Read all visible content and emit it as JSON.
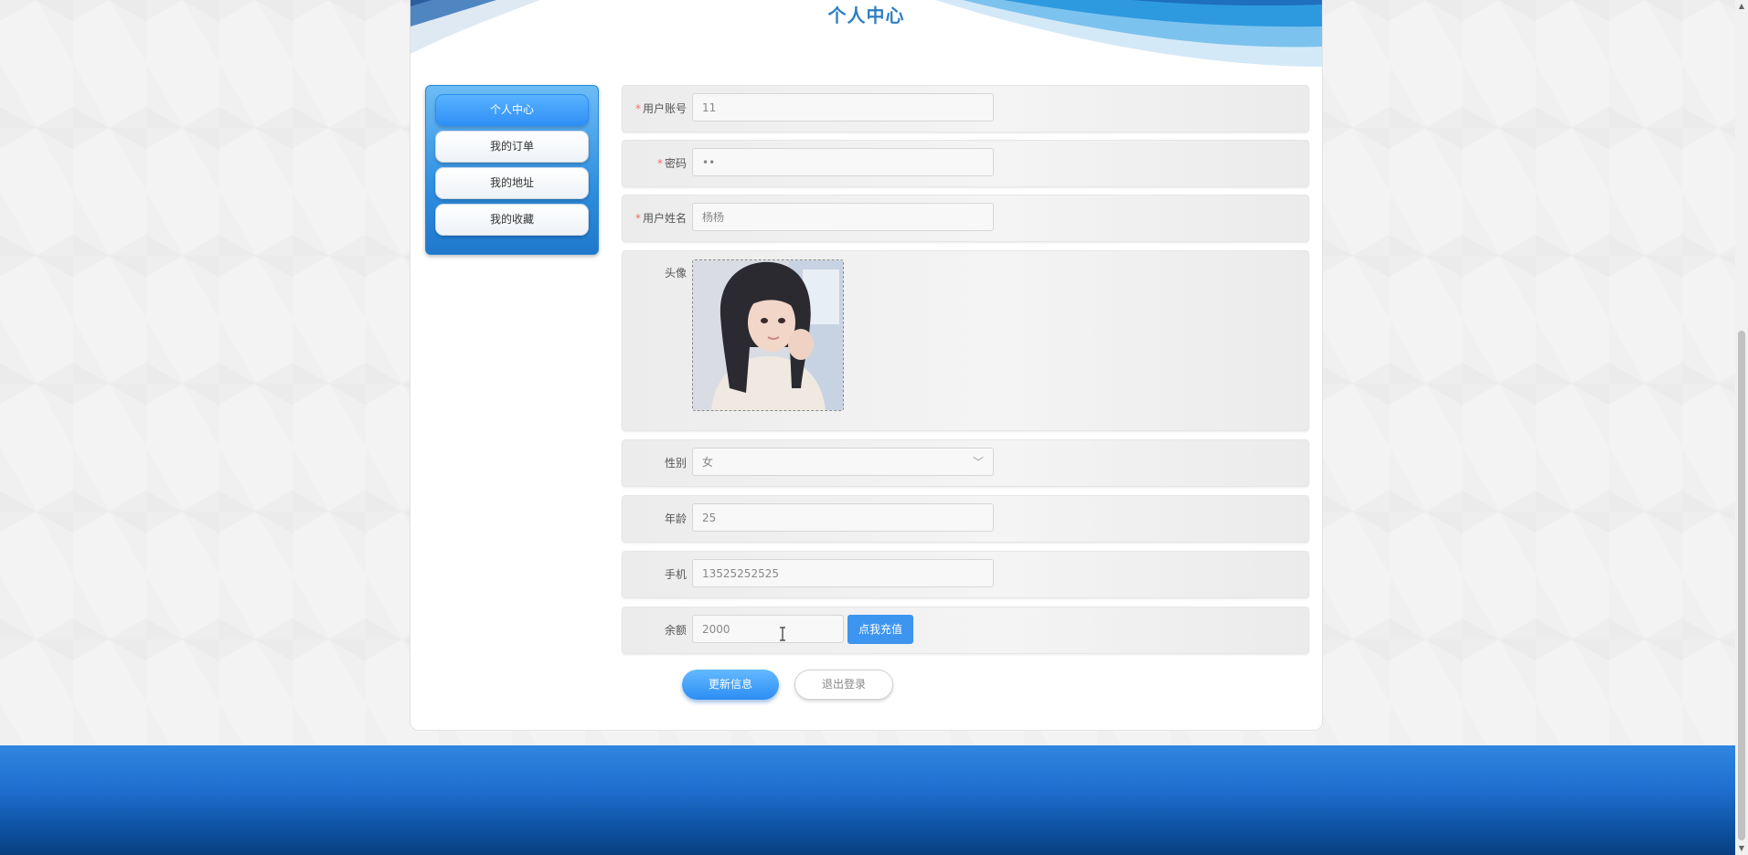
{
  "page": {
    "title": "个人中心"
  },
  "sidebar": {
    "items": [
      {
        "label": "个人中心",
        "active": true
      },
      {
        "label": "我的订单",
        "active": false
      },
      {
        "label": "我的地址",
        "active": false
      },
      {
        "label": "我的收藏",
        "active": false
      }
    ]
  },
  "form": {
    "required_mark": "*",
    "account": {
      "label": "用户账号",
      "value": "11"
    },
    "password": {
      "label": "密码",
      "value": "••"
    },
    "name": {
      "label": "用户姓名",
      "value": "杨杨"
    },
    "avatar": {
      "label": "头像"
    },
    "gender": {
      "label": "性别",
      "value": "女"
    },
    "age": {
      "label": "年龄",
      "value": "25"
    },
    "phone": {
      "label": "手机",
      "value": "13525252525"
    },
    "balance": {
      "label": "余额",
      "value": "2000",
      "recharge_label": "点我充值"
    }
  },
  "actions": {
    "update_label": "更新信息",
    "logout_label": "退出登录"
  },
  "colors": {
    "accent": "#3d95f0",
    "title": "#2f7fc2",
    "required": "#f56c6c",
    "footer": "#1f6fd0"
  },
  "icons": {
    "select_arrow": "chevron-down-icon",
    "cursor": "text-cursor-icon"
  }
}
